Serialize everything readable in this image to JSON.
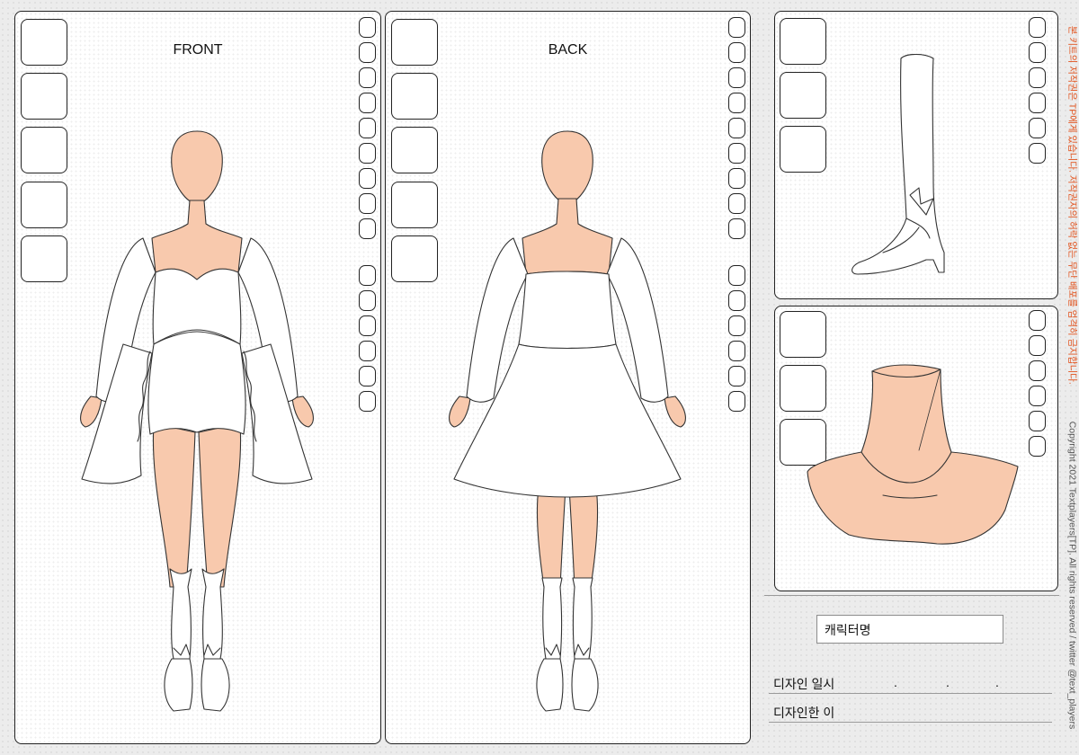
{
  "front_panel": {
    "title": "FRONT"
  },
  "back_panel": {
    "title": "BACK"
  },
  "form": {
    "character_name_label": "캐릭터명",
    "design_date_label": "디자인 일시",
    "date_separators": [
      ".",
      ".",
      "."
    ],
    "designer_label": "디자인한 이"
  },
  "copyright": {
    "main": "Copyright 2021  Textplayers[TP]. All rights reserved  / twitter @text_players",
    "notice": "본 키트의 저작권은 TP에게 있습니다. 저작권자의 허락 없는 무단 배포를 엄격히 금지합니다."
  },
  "colors": {
    "skin": "#f8c9ad",
    "outline": "#333333",
    "panel_border": "#222222",
    "notice_text": "#e2531e"
  }
}
